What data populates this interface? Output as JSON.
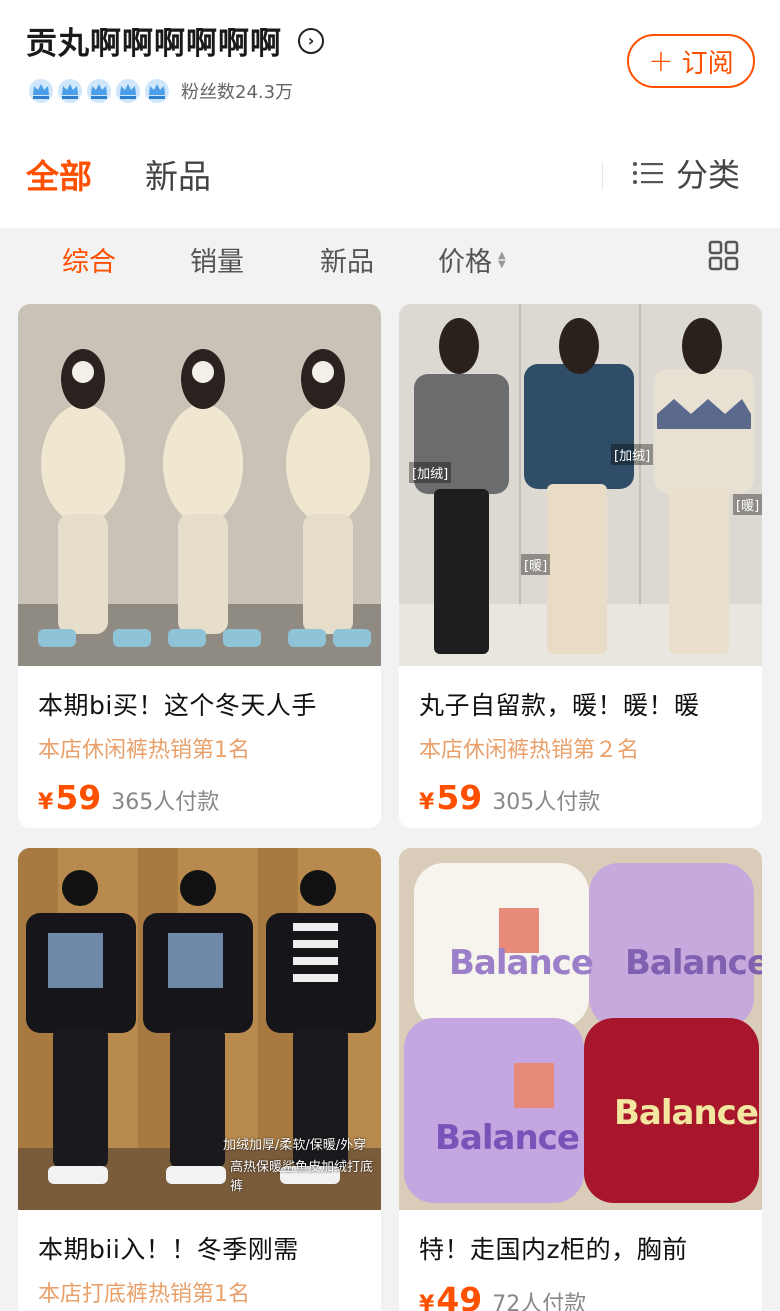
{
  "shop": {
    "name": "贡丸啊啊啊啊啊啊",
    "fans": "粉丝数24.3万",
    "subscribe_label": "订阅",
    "subscribe_plus": "+",
    "crown_count": 5
  },
  "tabs": {
    "all": "全部",
    "new": "新品",
    "category": "分类"
  },
  "sort": {
    "overall": "综合",
    "sales": "销量",
    "new": "新品",
    "price": "价格"
  },
  "colors": {
    "accent": "#ff5000",
    "badge": "#e9a06a",
    "crown": "#4a9fe8"
  },
  "products": [
    {
      "title": "本期bi买！这个冬天人手",
      "badge": "本店休闲裤热销第1名",
      "currency": "¥",
      "price": "59",
      "buyers": "365人付款",
      "image_tags": []
    },
    {
      "title": "丸子自留款，暖！暖！暖",
      "badge": "本店休闲裤热销第２名",
      "currency": "¥",
      "price": "59",
      "buyers": "305人付款",
      "image_tags": [
        "[加绒]",
        "[加绒]",
        "[暖]",
        "[暖]"
      ]
    },
    {
      "title": "本期bii入！！冬季刚需",
      "badge": "本店打底裤热销第1名",
      "currency": "¥",
      "price": "",
      "buyers": "",
      "image_tags": [
        "加绒加厚/柔软/保暖/外穿",
        "高热保暖鲨鱼皮加绒打底裤"
      ]
    },
    {
      "title": "特！走国内z柜的，胸前",
      "badge": "",
      "currency": "¥",
      "price": "49",
      "buyers": "72人付款",
      "image_tags": [
        "Balance",
        "Balance",
        "Balance",
        "Balance"
      ]
    }
  ]
}
